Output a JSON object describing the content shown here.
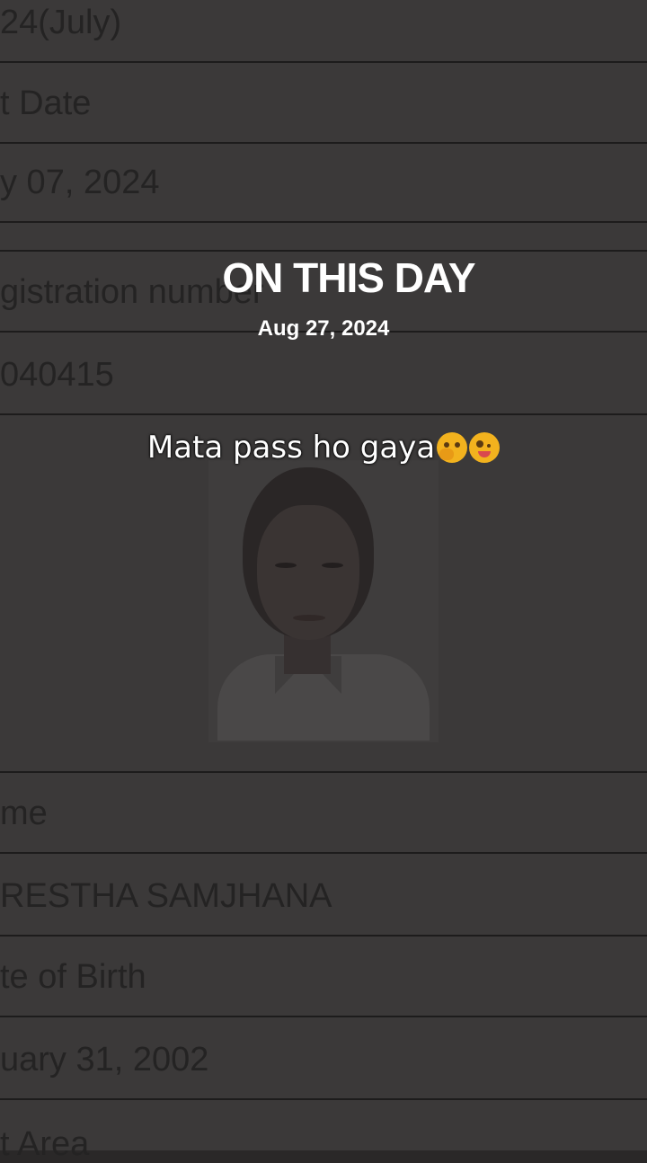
{
  "document": {
    "rows": [
      {
        "text": "24(July)"
      },
      {
        "text": "t Date"
      },
      {
        "text": "y 07, 2024"
      },
      {
        "text": "gistration number"
      },
      {
        "text": " 040415"
      },
      {
        "text": "me"
      },
      {
        "text": "RESTHA SAMJHANA"
      },
      {
        "text": "te of Birth"
      },
      {
        "text": "uary 31, 2002"
      },
      {
        "text": "t Area"
      }
    ]
  },
  "overlay": {
    "title": "ON THIS DAY",
    "date": "Aug 27, 2024",
    "caption": "Mata pass ho gaya",
    "emojis": [
      "face-with-hand-over-mouth-emoji",
      "zany-face-emoji"
    ]
  }
}
